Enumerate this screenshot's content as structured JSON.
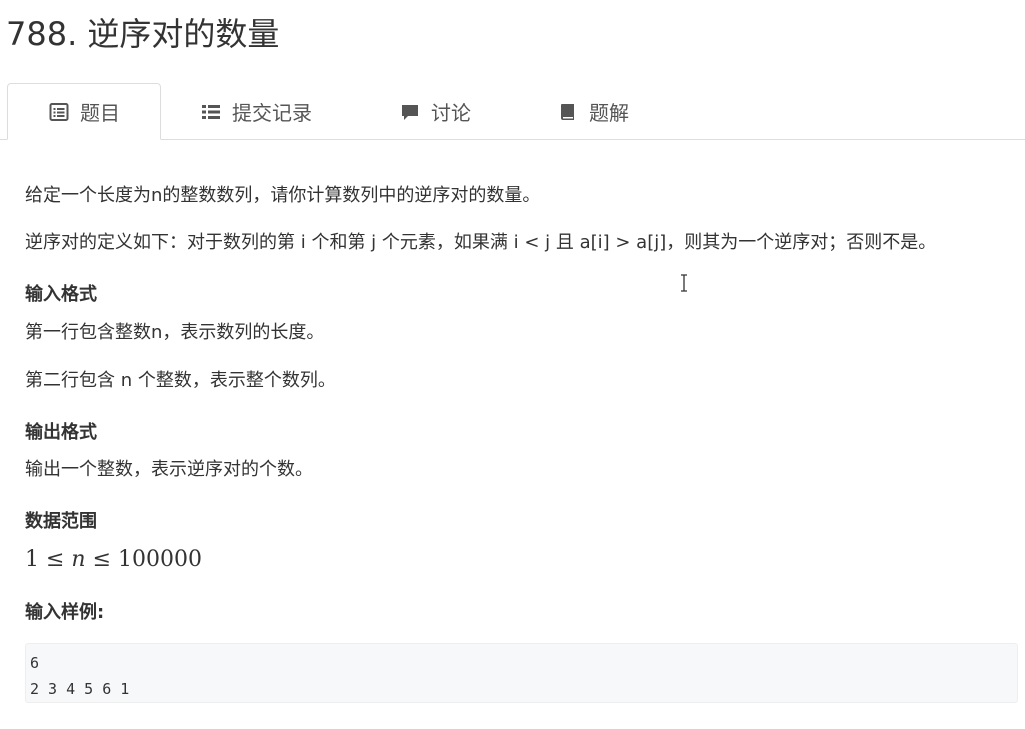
{
  "problem": {
    "title": "788. 逆序对的数量"
  },
  "tabs": [
    {
      "label": "题目",
      "icon": "list-alt-icon",
      "active": true
    },
    {
      "label": "提交记录",
      "icon": "list-icon",
      "active": false
    },
    {
      "label": "讨论",
      "icon": "comment-icon",
      "active": false
    },
    {
      "label": "题解",
      "icon": "book-icon",
      "active": false
    }
  ],
  "description": {
    "p1": "给定一个长度为n的整数数列，请你计算数列中的逆序对的数量。",
    "p2": "逆序对的定义如下：对于数列的第 i 个和第 j 个元素，如果满 i < j 且 a[i] > a[j]，则其为一个逆序对；否则不是。"
  },
  "input_format": {
    "heading": "输入格式",
    "line1": "第一行包含整数n，表示数列的长度。",
    "line2": "第二行包含 n 个整数，表示整个数列。"
  },
  "output_format": {
    "heading": "输出格式",
    "line1": "输出一个整数，表示逆序对的个数。"
  },
  "data_range": {
    "heading": "数据范围",
    "lhs": "1 ≤ ",
    "var": "n",
    "rhs": " ≤ 100000"
  },
  "sample_input": {
    "heading": "输入样例:",
    "lines": [
      "6",
      "2 3 4 5 6 1"
    ]
  }
}
